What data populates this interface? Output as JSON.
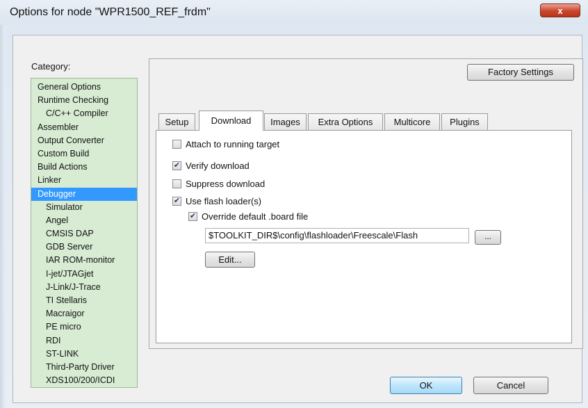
{
  "window": {
    "title": "Options for node \"WPR1500_REF_frdm\"",
    "close_label": "x"
  },
  "category": {
    "label": "Category:",
    "items": [
      {
        "label": "General Options",
        "sub": false,
        "selected": false
      },
      {
        "label": "Runtime Checking",
        "sub": false,
        "selected": false
      },
      {
        "label": "C/C++ Compiler",
        "sub": true,
        "selected": false
      },
      {
        "label": "Assembler",
        "sub": false,
        "selected": false
      },
      {
        "label": "Output Converter",
        "sub": false,
        "selected": false
      },
      {
        "label": "Custom Build",
        "sub": false,
        "selected": false
      },
      {
        "label": "Build Actions",
        "sub": false,
        "selected": false
      },
      {
        "label": "Linker",
        "sub": false,
        "selected": false
      },
      {
        "label": "Debugger",
        "sub": false,
        "selected": true
      },
      {
        "label": "Simulator",
        "sub": true,
        "selected": false
      },
      {
        "label": "Angel",
        "sub": true,
        "selected": false
      },
      {
        "label": "CMSIS DAP",
        "sub": true,
        "selected": false
      },
      {
        "label": "GDB Server",
        "sub": true,
        "selected": false
      },
      {
        "label": "IAR ROM-monitor",
        "sub": true,
        "selected": false
      },
      {
        "label": "I-jet/JTAGjet",
        "sub": true,
        "selected": false
      },
      {
        "label": "J-Link/J-Trace",
        "sub": true,
        "selected": false
      },
      {
        "label": "TI Stellaris",
        "sub": true,
        "selected": false
      },
      {
        "label": "Macraigor",
        "sub": true,
        "selected": false
      },
      {
        "label": "PE micro",
        "sub": true,
        "selected": false
      },
      {
        "label": "RDI",
        "sub": true,
        "selected": false
      },
      {
        "label": "ST-LINK",
        "sub": true,
        "selected": false
      },
      {
        "label": "Third-Party Driver",
        "sub": true,
        "selected": false
      },
      {
        "label": "XDS100/200/ICDI",
        "sub": true,
        "selected": false
      }
    ]
  },
  "factory_settings_label": "Factory Settings",
  "tabs": [
    {
      "label": "Setup",
      "active": false
    },
    {
      "label": "Download",
      "active": true
    },
    {
      "label": "Images",
      "active": false
    },
    {
      "label": "Extra Options",
      "active": false
    },
    {
      "label": "Multicore",
      "active": false
    },
    {
      "label": "Plugins",
      "active": false
    }
  ],
  "download": {
    "attach": {
      "label": "Attach to running target",
      "checked": false
    },
    "verify": {
      "label": "Verify download",
      "checked": true
    },
    "suppress": {
      "label": "Suppress download",
      "checked": false
    },
    "flash_loader": {
      "label": "Use flash loader(s)",
      "checked": true
    },
    "override_board": {
      "label": "Override default .board file",
      "checked": true
    },
    "board_path": "$TOOLKIT_DIR$\\config\\flashloader\\Freescale\\Flash",
    "browse_label": "...",
    "edit_label": "Edit..."
  },
  "footer": {
    "ok_label": "OK",
    "cancel_label": "Cancel"
  },
  "colors": {
    "category_bg": "#d7ecd3",
    "selection": "#3399ff",
    "close_button": "#c9452b"
  }
}
